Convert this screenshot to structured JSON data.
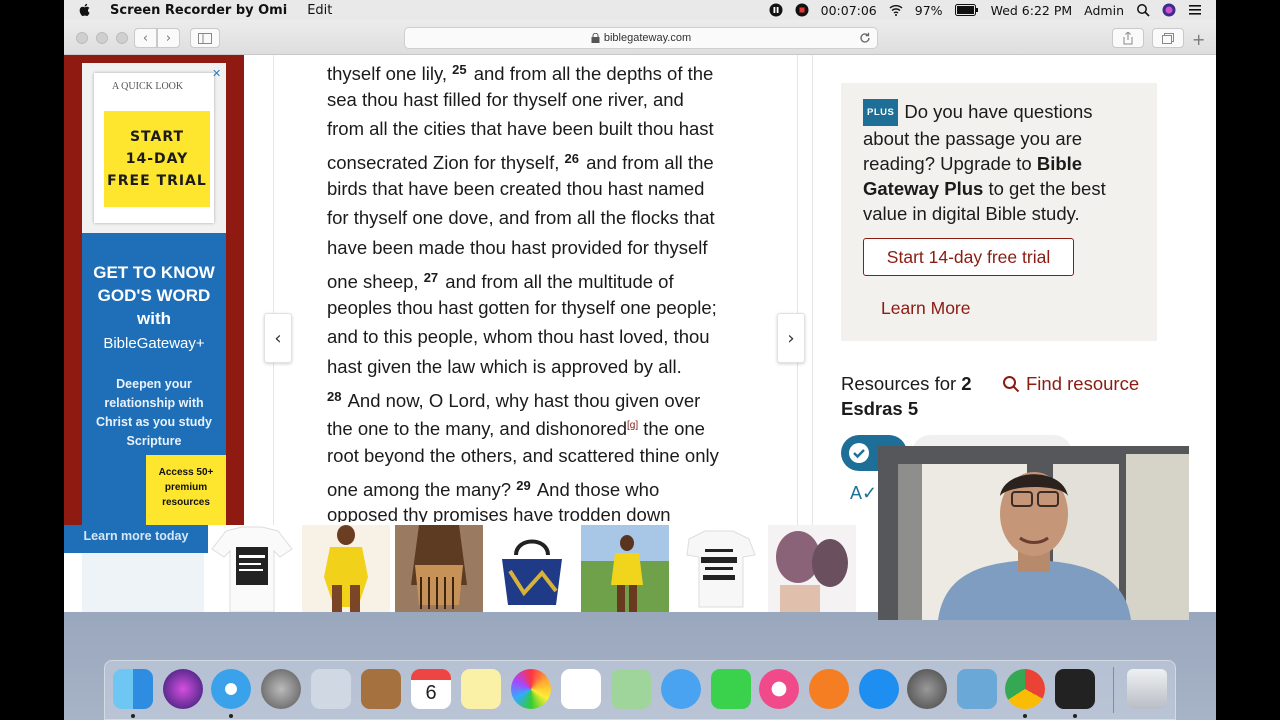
{
  "menubar": {
    "app_name": "Screen Recorder by Omi",
    "menu_edit": "Edit",
    "recording_time": "00:07:06",
    "battery": "97%",
    "clock": "Wed 6:22 PM",
    "user": "Admin"
  },
  "browser": {
    "url": "biblegateway.com"
  },
  "left_ad": {
    "quick_look": "A QUICK LOOK",
    "yellow_lines": [
      "START",
      "14-DAY",
      "FREE TRIAL"
    ],
    "headline_lines": [
      "GET TO KNOW",
      "GOD'S WORD",
      "with"
    ],
    "brand": "BibleGateway+",
    "deepen_lines": [
      "Deepen your",
      "relationship with",
      "Christ as you study",
      "Scripture"
    ],
    "access_lines": [
      "Access 50+",
      "premium",
      "resources"
    ],
    "learn_more_today": "Learn more today"
  },
  "scripture": {
    "lines": [
      {
        "parts": [
          {
            "t": "thyself one lily, "
          },
          {
            "v": "25"
          },
          {
            "t": " and from all the depths of the"
          }
        ]
      },
      {
        "parts": [
          {
            "t": "sea thou hast filled for thyself one river, and"
          }
        ]
      },
      {
        "parts": [
          {
            "t": "from all the cities that have been built thou hast"
          }
        ]
      },
      {
        "parts": [
          {
            "t": "consecrated Zion for thyself, "
          },
          {
            "v": "26"
          },
          {
            "t": " and from all the"
          }
        ]
      },
      {
        "parts": [
          {
            "t": "birds that have been created thou hast named"
          }
        ]
      },
      {
        "parts": [
          {
            "t": "for thyself one dove, and from all the flocks that"
          }
        ]
      },
      {
        "parts": [
          {
            "t": "have been made thou hast provided for thyself"
          }
        ]
      },
      {
        "parts": [
          {
            "t": "one sheep, "
          },
          {
            "v": "27"
          },
          {
            "t": " and from all the multitude of"
          }
        ]
      },
      {
        "parts": [
          {
            "t": "peoples thou hast gotten for thyself one people;"
          }
        ]
      },
      {
        "parts": [
          {
            "t": "and to this people, whom thou hast loved, thou"
          }
        ]
      },
      {
        "parts": [
          {
            "t": "hast given the law which is approved by all."
          }
        ]
      },
      {
        "parts": [
          {
            "v": "28"
          },
          {
            "t": " And now, O Lord, why hast thou given over"
          }
        ]
      },
      {
        "parts": [
          {
            "t": "the one to the many, and dishonored"
          },
          {
            "f": "[g]"
          },
          {
            "t": " the one"
          }
        ]
      },
      {
        "parts": [
          {
            "t": "root beyond the others, and scattered thine only"
          }
        ]
      },
      {
        "parts": [
          {
            "t": "one among the many? "
          },
          {
            "v": "29"
          },
          {
            "t": " And those who"
          }
        ]
      },
      {
        "parts": [
          {
            "t": "opposed thy promises have trodden down"
          }
        ]
      }
    ]
  },
  "sidebar": {
    "plus_badge": "PLUS",
    "plus_text_1": "Do you have questions about the passage you are reading? Upgrade to ",
    "plus_text_bold": "Bible Gateway Plus",
    "plus_text_2": " to get the best value in digital Bible study.",
    "trial_button": "Start 14-day free trial",
    "learn_more": "Learn More",
    "resources_label": "Resources for ",
    "resources_passage": "2 Esdras 5",
    "find_resource": "Find resource"
  },
  "colors": {
    "accent_red": "#8a1c12",
    "plus_blue": "#1e6f97"
  }
}
